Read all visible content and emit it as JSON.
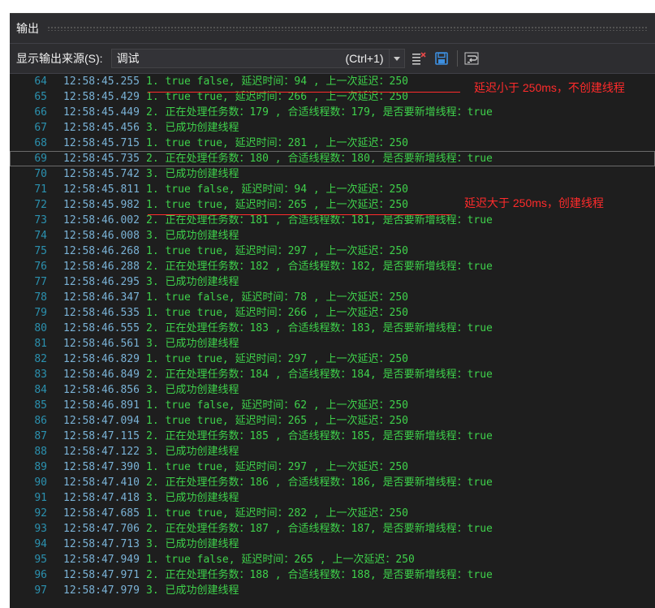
{
  "window": {
    "title": "输出"
  },
  "toolbar": {
    "source_label": "显示输出来源(S):",
    "source_value": "调试",
    "shortcut": "(Ctrl+1)",
    "icons": [
      "clear-all-icon",
      "save-icon",
      "word-wrap-icon"
    ]
  },
  "colors": {
    "background": "#1e1e1e",
    "line_number": "#2b91af",
    "timestamp": "#7ab2d6",
    "message": "#3fd14b",
    "annotation": "#ff2b2b"
  },
  "lines": [
    {
      "n": "64",
      "t": "12:58:45.255",
      "m": "1.  true  false, 延迟时间：94 , 上一次延迟：250"
    },
    {
      "n": "65",
      "t": "12:58:45.429",
      "m": "1.  true  true, 延迟时间：266 , 上一次延迟：250"
    },
    {
      "n": "66",
      "t": "12:58:45.449",
      "m": "2. 正在处理任务数：179 , 合适线程数：179, 是否要新增线程：true"
    },
    {
      "n": "67",
      "t": "12:58:45.456",
      "m": "3.  已成功创建线程"
    },
    {
      "n": "68",
      "t": "12:58:45.715",
      "m": "1.  true  true, 延迟时间：281 , 上一次延迟：250"
    },
    {
      "n": "69",
      "t": "12:58:45.735",
      "m": "2. 正在处理任务数：180 , 合适线程数：180, 是否要新增线程：true"
    },
    {
      "n": "70",
      "t": "12:58:45.742",
      "m": "3.  已成功创建线程"
    },
    {
      "n": "71",
      "t": "12:58:45.811",
      "m": "1.  true  false, 延迟时间：94 , 上一次延迟：250"
    },
    {
      "n": "72",
      "t": "12:58:45.982",
      "m": "1.  true  true, 延迟时间：265 , 上一次延迟：250"
    },
    {
      "n": "73",
      "t": "12:58:46.002",
      "m": "2. 正在处理任务数：181 , 合适线程数：181, 是否要新增线程：true"
    },
    {
      "n": "74",
      "t": "12:58:46.008",
      "m": "3.  已成功创建线程"
    },
    {
      "n": "75",
      "t": "12:58:46.268",
      "m": "1.  true  true, 延迟时间：297 , 上一次延迟：250"
    },
    {
      "n": "76",
      "t": "12:58:46.288",
      "m": "2. 正在处理任务数：182 , 合适线程数：182, 是否要新增线程：true"
    },
    {
      "n": "77",
      "t": "12:58:46.295",
      "m": "3.  已成功创建线程"
    },
    {
      "n": "78",
      "t": "12:58:46.347",
      "m": "1.  true  false, 延迟时间：78 , 上一次延迟：250"
    },
    {
      "n": "79",
      "t": "12:58:46.535",
      "m": "1.  true  true, 延迟时间：266 , 上一次延迟：250"
    },
    {
      "n": "80",
      "t": "12:58:46.555",
      "m": "2. 正在处理任务数：183 , 合适线程数：183, 是否要新增线程：true"
    },
    {
      "n": "81",
      "t": "12:58:46.561",
      "m": "3.  已成功创建线程"
    },
    {
      "n": "82",
      "t": "12:58:46.829",
      "m": "1.  true  true, 延迟时间：297 , 上一次延迟：250"
    },
    {
      "n": "83",
      "t": "12:58:46.849",
      "m": "2. 正在处理任务数：184 , 合适线程数：184, 是否要新增线程：true"
    },
    {
      "n": "84",
      "t": "12:58:46.856",
      "m": "3.  已成功创建线程"
    },
    {
      "n": "85",
      "t": "12:58:46.891",
      "m": "1.  true  false, 延迟时间：62 , 上一次延迟：250"
    },
    {
      "n": "86",
      "t": "12:58:47.094",
      "m": "1.  true  true, 延迟时间：265 , 上一次延迟：250"
    },
    {
      "n": "87",
      "t": "12:58:47.115",
      "m": "2. 正在处理任务数：185 , 合适线程数：185, 是否要新增线程：true"
    },
    {
      "n": "88",
      "t": "12:58:47.122",
      "m": "3.  已成功创建线程"
    },
    {
      "n": "89",
      "t": "12:58:47.390",
      "m": "1.  true  true, 延迟时间：297 , 上一次延迟：250"
    },
    {
      "n": "90",
      "t": "12:58:47.410",
      "m": "2. 正在处理任务数：186 , 合适线程数：186, 是否要新增线程：true"
    },
    {
      "n": "91",
      "t": "12:58:47.418",
      "m": "3.  已成功创建线程"
    },
    {
      "n": "92",
      "t": "12:58:47.685",
      "m": "1.  true  true, 延迟时间：282 , 上一次延迟：250"
    },
    {
      "n": "93",
      "t": "12:58:47.706",
      "m": "2. 正在处理任务数：187 , 合适线程数：187, 是否要新增线程：true"
    },
    {
      "n": "94",
      "t": "12:58:47.713",
      "m": "3.  已成功创建线程"
    },
    {
      "n": "95",
      "t": "12:58:47.949",
      "m": "1.  true  false, 延迟时间：265 , 上一次延迟：250"
    },
    {
      "n": "96",
      "t": "12:58:47.971",
      "m": "2. 正在处理任务数：188 , 合适线程数：188, 是否要新增线程：true"
    },
    {
      "n": "97",
      "t": "12:58:47.979",
      "m": "3.  已成功创建线程"
    }
  ],
  "annotations": {
    "first": "延迟小于 250ms，不创建线程",
    "second": "延迟大于 250ms，创建线程"
  }
}
